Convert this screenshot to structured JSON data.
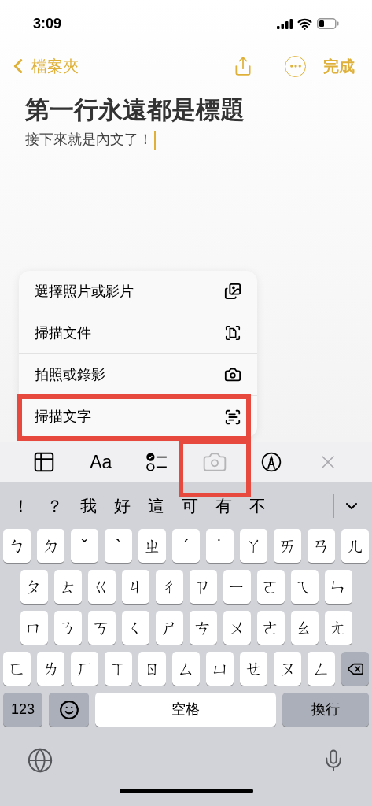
{
  "status_bar": {
    "time": "3:09"
  },
  "nav": {
    "back_label": "檔案夾",
    "done_label": "完成"
  },
  "note": {
    "title": "第一行永遠都是標題",
    "body": "接下來就是內文了！"
  },
  "menu": [
    {
      "label": "選擇照片或影片",
      "kind": "photos",
      "highlighted": false
    },
    {
      "label": "掃描文件",
      "kind": "scan-document",
      "highlighted": false
    },
    {
      "label": "拍照或錄影",
      "kind": "camera",
      "highlighted": false
    },
    {
      "label": "掃描文字",
      "kind": "scan-text",
      "highlighted": true
    }
  ],
  "toolbar": [
    {
      "kind": "table",
      "active": false,
      "highlighted": false
    },
    {
      "kind": "format",
      "label": "Aa",
      "active": false,
      "highlighted": false
    },
    {
      "kind": "checklist",
      "active": false,
      "highlighted": false
    },
    {
      "kind": "camera",
      "active": true,
      "highlighted": true
    },
    {
      "kind": "markup",
      "active": false,
      "highlighted": false
    },
    {
      "kind": "close",
      "active": false,
      "highlighted": false
    }
  ],
  "keyboard": {
    "candidates": [
      "！",
      "？",
      "我",
      "好",
      "這",
      "可",
      "有",
      "不"
    ],
    "rows": [
      [
        "ㄅ",
        "ㄉ",
        "ˇ",
        "ˋ",
        "ㄓ",
        "ˊ",
        "˙",
        "ㄚ",
        "ㄞ",
        "ㄢ",
        "ㄦ"
      ],
      [
        "ㄆ",
        "ㄊ",
        "ㄍ",
        "ㄐ",
        "ㄔ",
        "ㄗ",
        "ㄧ",
        "ㄛ",
        "ㄟ",
        "ㄣ"
      ],
      [
        "ㄇ",
        "ㄋ",
        "ㄎ",
        "ㄑ",
        "ㄕ",
        "ㄘ",
        "ㄨ",
        "ㄜ",
        "ㄠ",
        "ㄤ"
      ],
      [
        "ㄈ",
        "ㄌ",
        "ㄏ",
        "ㄒ",
        "ㄖ",
        "ㄙ",
        "ㄩ",
        "ㄝ",
        "ㄡ",
        "ㄥ"
      ]
    ],
    "numbers_key": "123",
    "space_key": "空格",
    "return_key": "換行"
  }
}
